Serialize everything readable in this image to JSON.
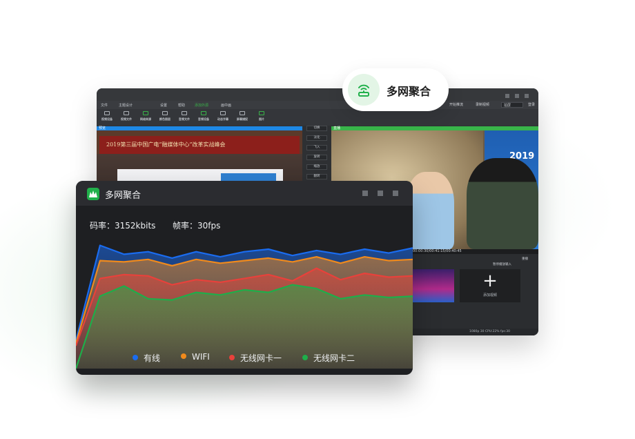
{
  "app": {
    "menus": [
      "文件",
      "主题设计",
      "设置",
      "帮助",
      "添加外源",
      "画中画"
    ],
    "active_menu": "添加外源",
    "right_controls": [
      "开始推流",
      "录制视频",
      "拍屏",
      "登录"
    ],
    "tools": [
      "视频设备",
      "视频文件",
      "网络来源",
      "颜色图层",
      "音频文件",
      "音频设备",
      "动态字幕",
      "屏幕捕捉",
      "图片"
    ],
    "preview_label": "预览",
    "live_label": "直播",
    "preview_banner": "2019第三届中国广电“融媒体中心”改革实战峰会",
    "side_buttons": [
      "切换",
      "淡化",
      "飞入",
      "旋转",
      "缩放",
      "翻转"
    ],
    "live_badge": "2019",
    "timecode": "00:00:30/00:41:15/00:40:45",
    "sub_controls": [
      "重播",
      "暂停播放输入",
      "添加视频"
    ],
    "status": "1080p 30  CPU:22%  fps:30"
  },
  "pill": {
    "label": "多网聚合",
    "icon": "router-signal-icon",
    "accent": "#21b04b"
  },
  "panel": {
    "title": "多网聚合",
    "bitrate_label": "码率：3152kbits",
    "framerate_label": "帧率：30fps",
    "background": "#1e1f22"
  },
  "chart_data": {
    "type": "area",
    "title": "",
    "xlabel": "",
    "ylabel": "",
    "ylim": [
      0,
      100
    ],
    "x": [
      0,
      1,
      2,
      3,
      4,
      5,
      6,
      7,
      8,
      9,
      10,
      11,
      12,
      13,
      14
    ],
    "grid": false,
    "legend_position": "bottom",
    "series": [
      {
        "name": "有线",
        "color": "#1a6cf0",
        "values": [
          22,
          97,
          90,
          92,
          87,
          92,
          88,
          92,
          94,
          89,
          93,
          90,
          94,
          91,
          95
        ]
      },
      {
        "name": "WIFI",
        "color": "#f08a1c",
        "values": [
          20,
          85,
          84,
          86,
          81,
          86,
          83,
          85,
          87,
          84,
          88,
          83,
          88,
          85,
          86
        ]
      },
      {
        "name": "无线网卡一",
        "color": "#e8413b",
        "values": [
          18,
          71,
          74,
          73,
          66,
          70,
          68,
          71,
          74,
          69,
          79,
          70,
          75,
          72,
          73
        ]
      },
      {
        "name": "无线网卡二",
        "color": "#1eae4a",
        "values": [
          0,
          57,
          65,
          55,
          54,
          60,
          58,
          62,
          60,
          66,
          63,
          55,
          58,
          56,
          57
        ]
      }
    ]
  }
}
